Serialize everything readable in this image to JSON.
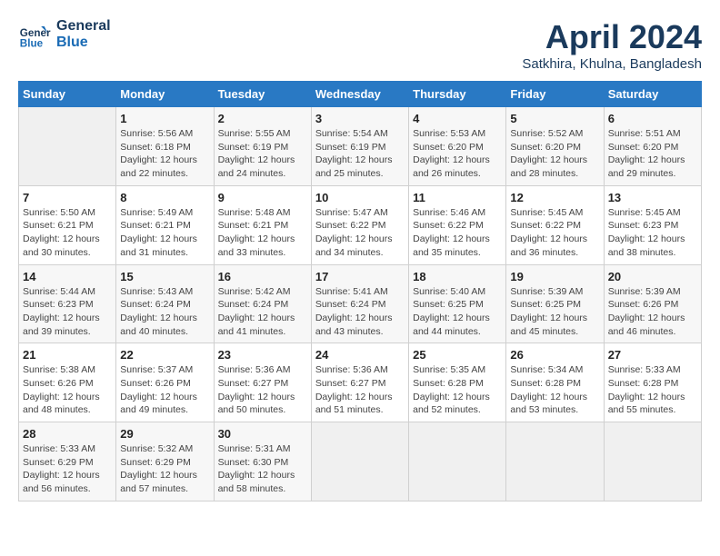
{
  "logo": {
    "line1": "General",
    "line2": "Blue"
  },
  "title": "April 2024",
  "subtitle": "Satkhira, Khulna, Bangladesh",
  "days_header": [
    "Sunday",
    "Monday",
    "Tuesday",
    "Wednesday",
    "Thursday",
    "Friday",
    "Saturday"
  ],
  "weeks": [
    [
      {
        "num": "",
        "info": ""
      },
      {
        "num": "1",
        "info": "Sunrise: 5:56 AM\nSunset: 6:18 PM\nDaylight: 12 hours\nand 22 minutes."
      },
      {
        "num": "2",
        "info": "Sunrise: 5:55 AM\nSunset: 6:19 PM\nDaylight: 12 hours\nand 24 minutes."
      },
      {
        "num": "3",
        "info": "Sunrise: 5:54 AM\nSunset: 6:19 PM\nDaylight: 12 hours\nand 25 minutes."
      },
      {
        "num": "4",
        "info": "Sunrise: 5:53 AM\nSunset: 6:20 PM\nDaylight: 12 hours\nand 26 minutes."
      },
      {
        "num": "5",
        "info": "Sunrise: 5:52 AM\nSunset: 6:20 PM\nDaylight: 12 hours\nand 28 minutes."
      },
      {
        "num": "6",
        "info": "Sunrise: 5:51 AM\nSunset: 6:20 PM\nDaylight: 12 hours\nand 29 minutes."
      }
    ],
    [
      {
        "num": "7",
        "info": "Sunrise: 5:50 AM\nSunset: 6:21 PM\nDaylight: 12 hours\nand 30 minutes."
      },
      {
        "num": "8",
        "info": "Sunrise: 5:49 AM\nSunset: 6:21 PM\nDaylight: 12 hours\nand 31 minutes."
      },
      {
        "num": "9",
        "info": "Sunrise: 5:48 AM\nSunset: 6:21 PM\nDaylight: 12 hours\nand 33 minutes."
      },
      {
        "num": "10",
        "info": "Sunrise: 5:47 AM\nSunset: 6:22 PM\nDaylight: 12 hours\nand 34 minutes."
      },
      {
        "num": "11",
        "info": "Sunrise: 5:46 AM\nSunset: 6:22 PM\nDaylight: 12 hours\nand 35 minutes."
      },
      {
        "num": "12",
        "info": "Sunrise: 5:45 AM\nSunset: 6:22 PM\nDaylight: 12 hours\nand 36 minutes."
      },
      {
        "num": "13",
        "info": "Sunrise: 5:45 AM\nSunset: 6:23 PM\nDaylight: 12 hours\nand 38 minutes."
      }
    ],
    [
      {
        "num": "14",
        "info": "Sunrise: 5:44 AM\nSunset: 6:23 PM\nDaylight: 12 hours\nand 39 minutes."
      },
      {
        "num": "15",
        "info": "Sunrise: 5:43 AM\nSunset: 6:24 PM\nDaylight: 12 hours\nand 40 minutes."
      },
      {
        "num": "16",
        "info": "Sunrise: 5:42 AM\nSunset: 6:24 PM\nDaylight: 12 hours\nand 41 minutes."
      },
      {
        "num": "17",
        "info": "Sunrise: 5:41 AM\nSunset: 6:24 PM\nDaylight: 12 hours\nand 43 minutes."
      },
      {
        "num": "18",
        "info": "Sunrise: 5:40 AM\nSunset: 6:25 PM\nDaylight: 12 hours\nand 44 minutes."
      },
      {
        "num": "19",
        "info": "Sunrise: 5:39 AM\nSunset: 6:25 PM\nDaylight: 12 hours\nand 45 minutes."
      },
      {
        "num": "20",
        "info": "Sunrise: 5:39 AM\nSunset: 6:26 PM\nDaylight: 12 hours\nand 46 minutes."
      }
    ],
    [
      {
        "num": "21",
        "info": "Sunrise: 5:38 AM\nSunset: 6:26 PM\nDaylight: 12 hours\nand 48 minutes."
      },
      {
        "num": "22",
        "info": "Sunrise: 5:37 AM\nSunset: 6:26 PM\nDaylight: 12 hours\nand 49 minutes."
      },
      {
        "num": "23",
        "info": "Sunrise: 5:36 AM\nSunset: 6:27 PM\nDaylight: 12 hours\nand 50 minutes."
      },
      {
        "num": "24",
        "info": "Sunrise: 5:36 AM\nSunset: 6:27 PM\nDaylight: 12 hours\nand 51 minutes."
      },
      {
        "num": "25",
        "info": "Sunrise: 5:35 AM\nSunset: 6:28 PM\nDaylight: 12 hours\nand 52 minutes."
      },
      {
        "num": "26",
        "info": "Sunrise: 5:34 AM\nSunset: 6:28 PM\nDaylight: 12 hours\nand 53 minutes."
      },
      {
        "num": "27",
        "info": "Sunrise: 5:33 AM\nSunset: 6:28 PM\nDaylight: 12 hours\nand 55 minutes."
      }
    ],
    [
      {
        "num": "28",
        "info": "Sunrise: 5:33 AM\nSunset: 6:29 PM\nDaylight: 12 hours\nand 56 minutes."
      },
      {
        "num": "29",
        "info": "Sunrise: 5:32 AM\nSunset: 6:29 PM\nDaylight: 12 hours\nand 57 minutes."
      },
      {
        "num": "30",
        "info": "Sunrise: 5:31 AM\nSunset: 6:30 PM\nDaylight: 12 hours\nand 58 minutes."
      },
      {
        "num": "",
        "info": ""
      },
      {
        "num": "",
        "info": ""
      },
      {
        "num": "",
        "info": ""
      },
      {
        "num": "",
        "info": ""
      }
    ]
  ]
}
